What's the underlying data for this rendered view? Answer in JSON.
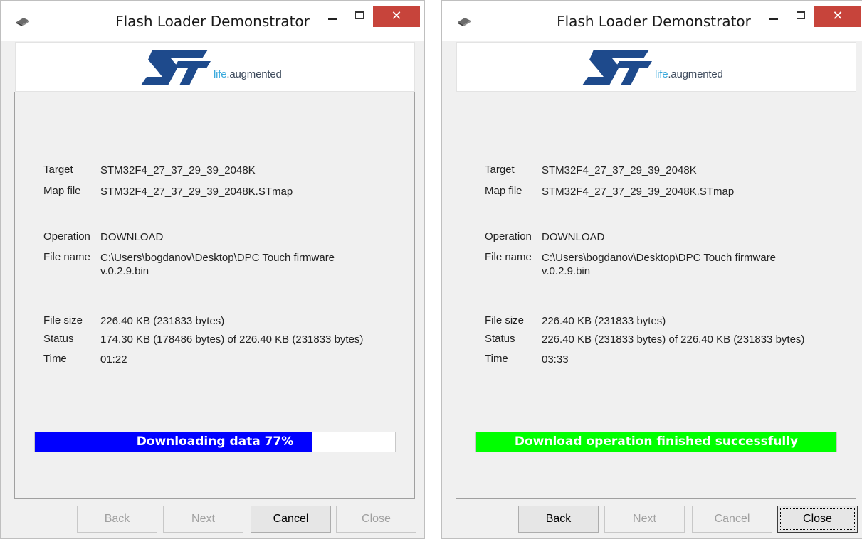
{
  "windows": [
    {
      "title": "Flash Loader Demonstrator",
      "close_glyph": "✕",
      "logo": {
        "brand": "ST",
        "tagline_a": "life",
        "tagline_b": ".augmented"
      },
      "fields": {
        "target_label": "Target",
        "target_value": "STM32F4_27_37_29_39_2048K",
        "map_label": "Map file",
        "map_value": "STM32F4_27_37_29_39_2048K.STmap",
        "operation_label": "Operation",
        "operation_value": "DOWNLOAD",
        "filename_label": "File name",
        "filename_value": "C:\\Users\\bogdanov\\Desktop\\DPC Touch firmware v.0.2.9.bin",
        "filesize_label": "File size",
        "filesize_value": "226.40 KB (231833 bytes)",
        "status_label": "Status",
        "status_value": "174.30 KB (178486 bytes) of 226.40 KB (231833 bytes)",
        "time_label": "Time",
        "time_value": "01:22"
      },
      "progress": {
        "text": "Downloading data 77%",
        "fraction": 0.77,
        "color": "#0000ff"
      },
      "buttons": {
        "back": "Back",
        "next": "Next",
        "cancel": "Cancel",
        "close": "Close"
      },
      "button_states": {
        "back": "disabled",
        "next": "disabled",
        "cancel": "enabled",
        "close": "disabled"
      }
    },
    {
      "title": "Flash Loader Demonstrator",
      "close_glyph": "✕",
      "logo": {
        "brand": "ST",
        "tagline_a": "life",
        "tagline_b": ".augmented"
      },
      "fields": {
        "target_label": "Target",
        "target_value": "STM32F4_27_37_29_39_2048K",
        "map_label": "Map file",
        "map_value": "STM32F4_27_37_29_39_2048K.STmap",
        "operation_label": "Operation",
        "operation_value": "DOWNLOAD",
        "filename_label": "File name",
        "filename_value": "C:\\Users\\bogdanov\\Desktop\\DPC Touch firmware v.0.2.9.bin",
        "filesize_label": "File size",
        "filesize_value": "226.40 KB (231833 bytes)",
        "status_label": "Status",
        "status_value": "226.40 KB (231833 bytes) of 226.40 KB (231833 bytes)",
        "time_label": "Time",
        "time_value": "03:33"
      },
      "progress": {
        "text": "Download operation finished successfully",
        "fraction": 1.0,
        "color": "#00ff00"
      },
      "buttons": {
        "back": "Back",
        "next": "Next",
        "cancel": "Cancel",
        "close": "Close"
      },
      "button_states": {
        "back": "enabled",
        "next": "disabled",
        "cancel": "disabled",
        "close": "focused"
      }
    }
  ]
}
